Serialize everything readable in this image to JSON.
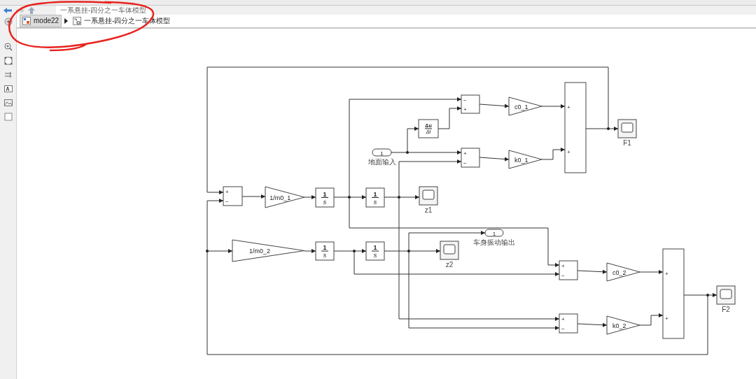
{
  "tab": {
    "title": "一系悬挂-四分之一车体模型",
    "selected": true
  },
  "breadcrumb": [
    {
      "kind": "model",
      "label": "mode22"
    },
    {
      "kind": "subsystem",
      "label": "一系悬挂-四分之一车体模型"
    }
  ],
  "blocks": [
    {
      "kind": "sum",
      "ports": [
        "−",
        "+"
      ]
    },
    {
      "kind": "gain",
      "label": "c0_1"
    },
    {
      "kind": "derivative",
      "numerator": "Δu",
      "denominator": "Δt"
    },
    {
      "kind": "inport",
      "number": "1",
      "label": "地面输入"
    },
    {
      "kind": "sum",
      "ports": [
        "+",
        "−"
      ]
    },
    {
      "kind": "gain",
      "label": "k0_1"
    },
    {
      "kind": "sum",
      "ports": [
        "+",
        "+"
      ]
    },
    {
      "kind": "scope",
      "label": "F1"
    },
    {
      "kind": "sum",
      "ports": [
        "+",
        "−"
      ]
    },
    {
      "kind": "gain",
      "label": "1/m0_1"
    },
    {
      "kind": "integrator",
      "numerator": "1",
      "denominator": "s"
    },
    {
      "kind": "integrator",
      "numerator": "1",
      "denominator": "s"
    },
    {
      "kind": "scope",
      "label": "z1"
    },
    {
      "kind": "outport",
      "number": "1",
      "label": "车身振动输出"
    },
    {
      "kind": "gain",
      "label": "1/m0_2"
    },
    {
      "kind": "integrator",
      "numerator": "1",
      "denominator": "s"
    },
    {
      "kind": "integrator",
      "numerator": "1",
      "denominator": "s"
    },
    {
      "kind": "scope",
      "label": "z2"
    },
    {
      "kind": "sum",
      "ports": [
        "+",
        "+"
      ]
    },
    {
      "kind": "sum",
      "ports": [
        "+",
        "−"
      ]
    },
    {
      "kind": "gain",
      "label": "c0_2"
    },
    {
      "kind": "scope",
      "label": "F2"
    },
    {
      "kind": "sum",
      "ports": [
        "+",
        "−"
      ]
    },
    {
      "kind": "gain",
      "label": "k0_2"
    }
  ]
}
